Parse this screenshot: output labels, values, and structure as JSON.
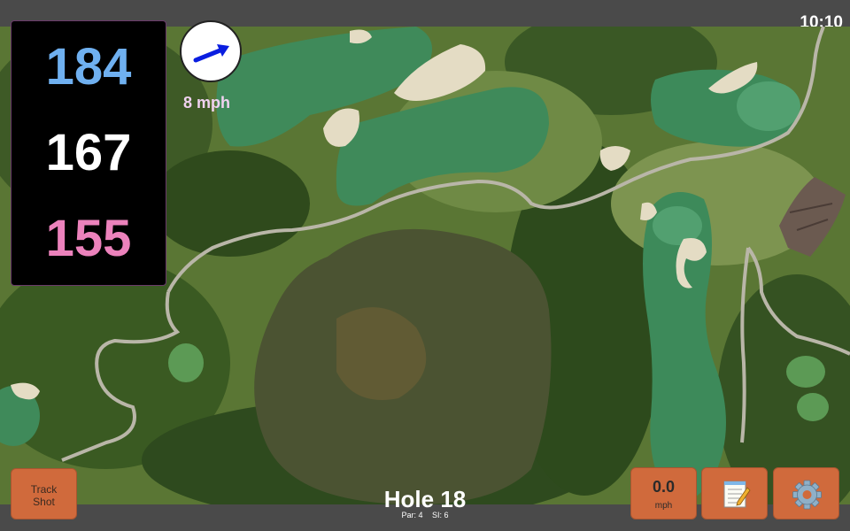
{
  "status": {
    "time": "10:10"
  },
  "yardage": {
    "back": "184",
    "middle": "167",
    "front": "155"
  },
  "wind": {
    "speed": "8 mph"
  },
  "hole": {
    "title": "Hole 18",
    "par": "Par: 4",
    "stroke_index": "SI: 6"
  },
  "buttons": {
    "track_shot_line1": "Track",
    "track_shot_line2": "Shot",
    "wind_value": "0.0",
    "wind_unit": "mph"
  },
  "icons": {
    "notes": "notepad-icon",
    "settings": "gear-icon",
    "wind": "wind-arrow-icon"
  },
  "colors": {
    "back_yardage": "#6fb0f0",
    "middle_yardage": "#ffffff",
    "front_yardage": "#ec82bc",
    "button": "#d06a3c"
  }
}
